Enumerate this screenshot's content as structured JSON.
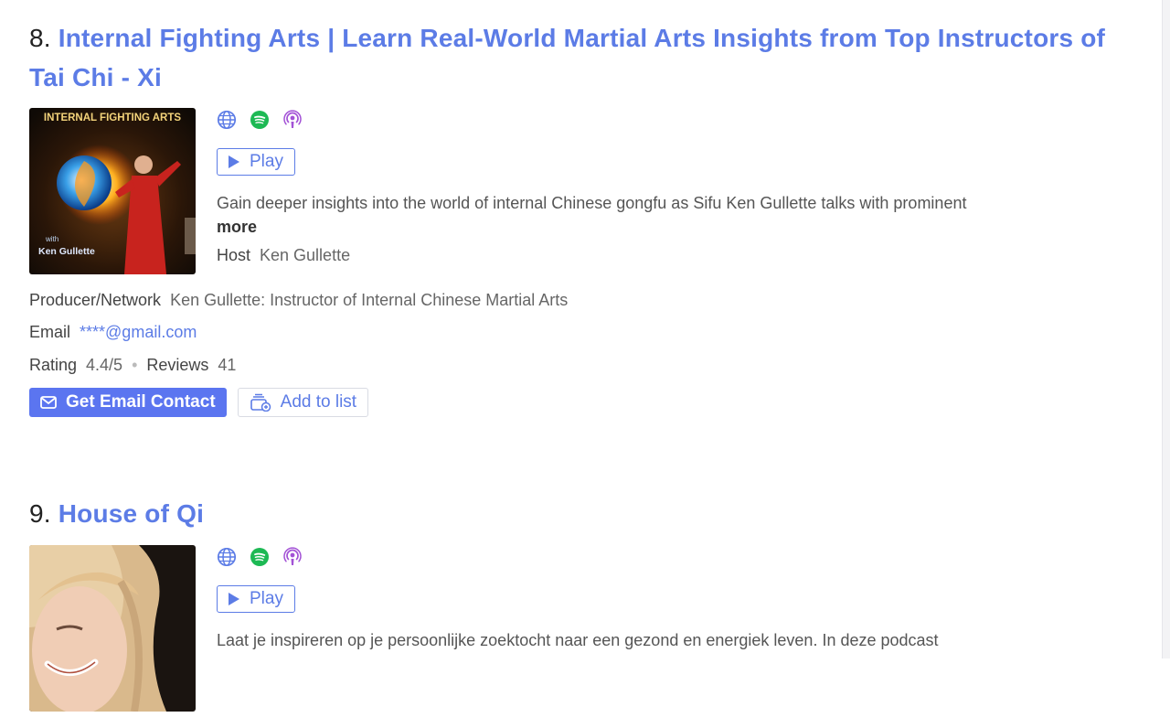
{
  "colors": {
    "link": "#5c7ce6",
    "primary": "#5b75f0",
    "spotify": "#1db954",
    "podcast": "#a352d6"
  },
  "results": [
    {
      "number": "8.",
      "title": "Internal Fighting Arts | Learn Real-World Martial Arts Insights from Top Instructors of Tai Chi - Xi",
      "cover_title": "INTERNAL FIGHTING ARTS",
      "cover_with": "with",
      "cover_name": "Ken Gullette",
      "icons": [
        "globe-icon",
        "spotify-icon",
        "podcast-icon"
      ],
      "play_label": "Play",
      "description": "Gain deeper insights into the world of internal Chinese gongfu as Sifu Ken Gullette talks with prominent",
      "more_label": "more",
      "host_label": "Host",
      "host": "Ken Gullette",
      "producer_label": "Producer/Network",
      "producer": "Ken Gullette: Instructor of Internal Chinese Martial Arts",
      "email_label": "Email",
      "email": "****@gmail.com",
      "rating_label": "Rating",
      "rating": "4.4/5",
      "reviews_label": "Reviews",
      "reviews": "41",
      "get_email_label": "Get Email Contact",
      "add_list_label": "Add to list"
    },
    {
      "number": "9.",
      "title": "House of Qi",
      "icons": [
        "globe-icon",
        "spotify-icon",
        "podcast-icon"
      ],
      "play_label": "Play",
      "description": "Laat je inspireren op je persoonlijke zoektocht naar een gezond en energiek leven. In deze podcast"
    }
  ]
}
